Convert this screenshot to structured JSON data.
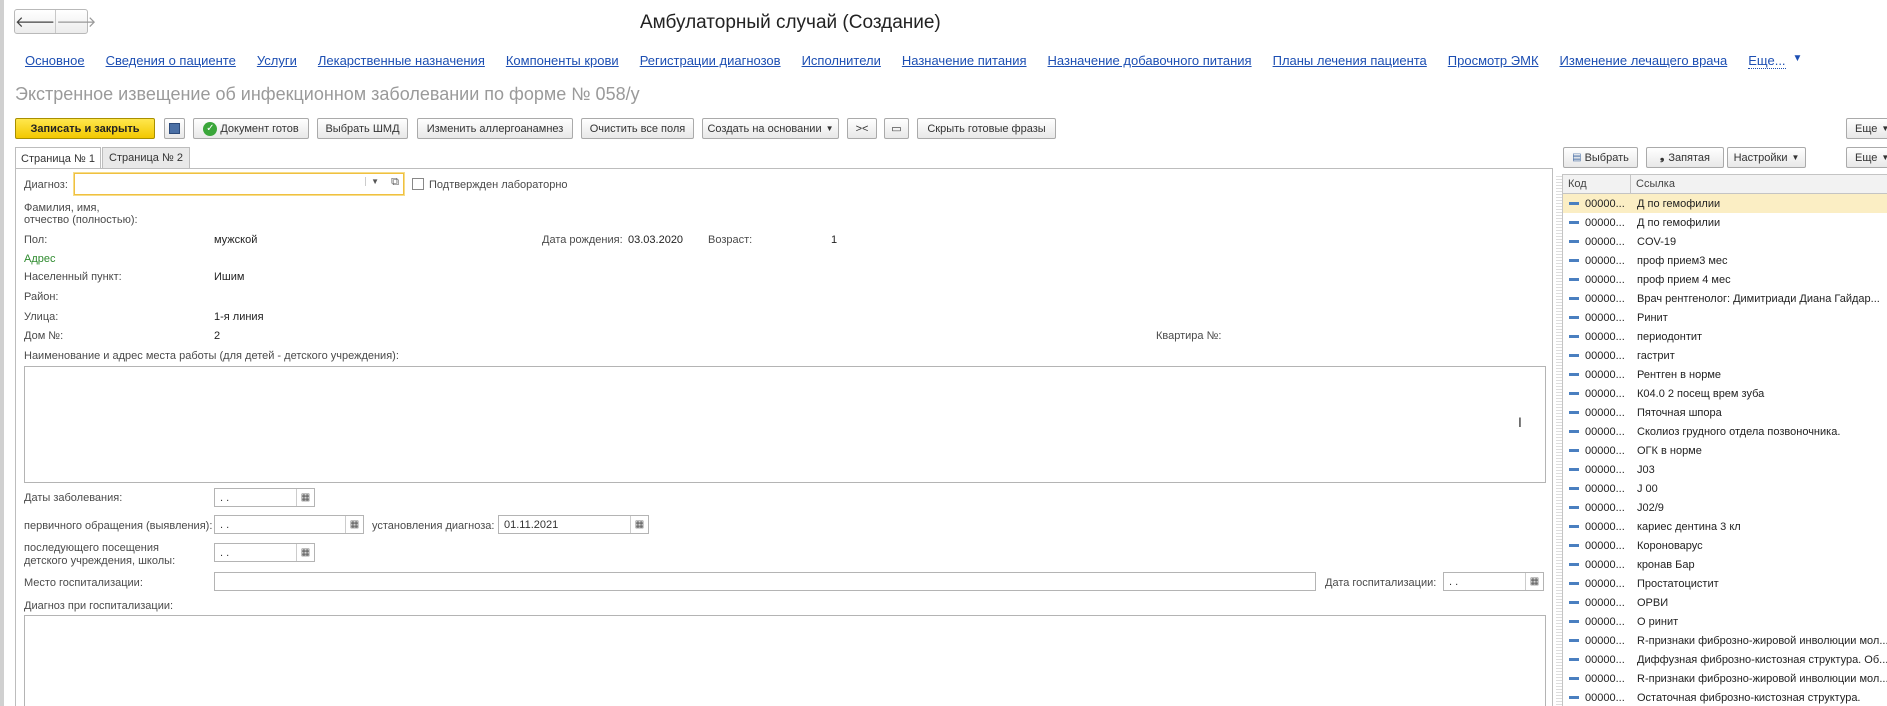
{
  "window": {
    "title": "Амбулаторный случай (Создание)",
    "back": "🡐",
    "forward": "🡒"
  },
  "nav_links": [
    "Основное",
    "Сведения о пациенте",
    "Услуги",
    "Лекарственные назначения",
    "Компоненты крови",
    "Регистрации диагнозов",
    "Исполнители",
    "Назначение питания",
    "Назначение добавочного питания",
    "Планы лечения пациента",
    "Просмотр ЭМК",
    "Изменение лечащего врача"
  ],
  "nav_more": "Еще...",
  "form_title": "Экстренное извещение об инфекционном заболевании по форме № 058/у",
  "toolbar": {
    "save_close": "Записать и закрыть",
    "doc_ready": "Документ готов",
    "choose_shmd": "Выбрать ШМД",
    "change_allergo": "Изменить аллергоанамнез",
    "clear_all": "Очистить все поля",
    "create_based": "Создать на основании",
    "arrows": "><",
    "hide_phrases": "Скрыть готовые фразы",
    "more": "Еще"
  },
  "tabs": [
    "Страница № 1",
    "Страница № 2"
  ],
  "form": {
    "diagnosis_label": "Диагноз:",
    "lab_confirmed": "Подтвержден лабораторно",
    "fio_label_1": "Фамилия, имя,",
    "fio_label_2": "отчество (полностью):",
    "sex_label": "Пол:",
    "sex_value": "мужской",
    "birth_label": "Дата рождения:",
    "birth_value": "03.03.2020",
    "age_label": "Возраст:",
    "age_value": "1",
    "address_header": "Адрес",
    "locality_label": "Населенный пункт:",
    "locality_value": "Ишим",
    "district_label": "Район:",
    "street_label": "Улица:",
    "street_value": "1-я линия",
    "house_label": "Дом №:",
    "house_value": "2",
    "apartment_label": "Квартира №:",
    "work_label": "Наименование и адрес места работы (для детей - детского учреждения):",
    "disease_dates_label": "Даты заболевания:",
    "date_placeholder": " .  .",
    "first_visit_label": "первичного обращения (выявления):",
    "diag_date_label": "установления диагноза:",
    "diag_date_value": "01.11.2021",
    "last_visit_label_1": "последующего посещения",
    "last_visit_label_2": "детского учреждения, школы:",
    "hosp_place_label": "Место госпитализации:",
    "hosp_date_label": "Дата госпитализации:",
    "hosp_diag_label": "Диагноз при госпитализации:"
  },
  "right_panel": {
    "choose": "Выбрать",
    "comma": "Запятая",
    "settings": "Настройки",
    "more": "Еще",
    "col_code": "Код",
    "col_link": "Ссылка",
    "code": "00000...",
    "rows": [
      "Д по гемофилии",
      "Д по гемофилии",
      "COV-19",
      "проф прием3 мес",
      "проф прием 4 мес",
      "Врач рентгенолог:  Димитриади Диана Гайдар...",
      "Ринит",
      "периодонтит",
      "гастрит",
      "Рентген в норме",
      "К04.0 2 посещ врем зуба",
      "Пяточная шпора",
      "Сколиоз грудного отдела позвоночника.",
      "ОГК в норме",
      "J03",
      "J 00",
      "J02/9",
      "кариес дентина 3 кл",
      "Короноварус",
      "кронав Бар",
      "Простатоцистит",
      "ОРВИ",
      "О ринит",
      "R-признаки фиброзно-жировой инволюции мол...",
      "Диффузная фиброзно-кистозная структура. Об...",
      "R-признаки фиброзно-жировой инволюции мол...",
      "Остаточная фиброзно-кистозная структура."
    ]
  }
}
